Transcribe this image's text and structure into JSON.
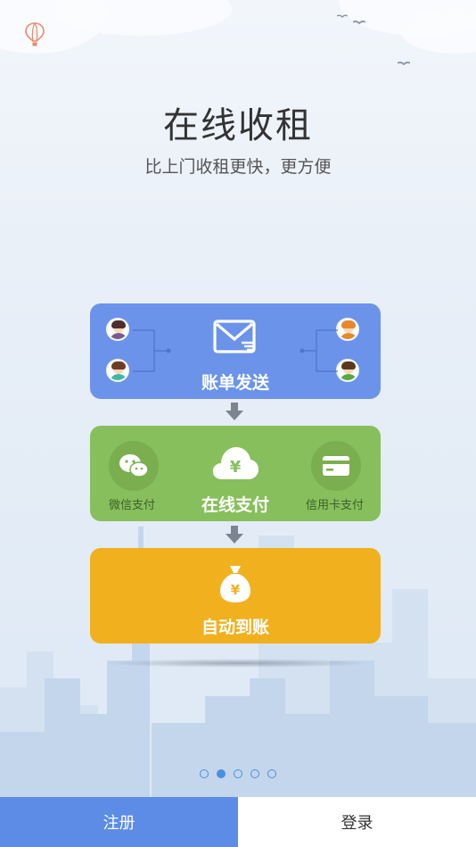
{
  "hero": {
    "title": "在线收租",
    "subtitle": "比上门收租更快，更方便"
  },
  "steps": [
    {
      "label": "账单发送",
      "icon": "mail-icon",
      "color": "#6b93ea"
    },
    {
      "label": "在线支付",
      "icon": "yuan-cloud-icon",
      "color": "#87bf5c",
      "methods": [
        {
          "label": "微信支付",
          "icon": "wechat-icon"
        },
        {
          "label": "信用卡支付",
          "icon": "credit-card-icon"
        }
      ]
    },
    {
      "label": "自动到账",
      "icon": "money-bag-icon",
      "color": "#f1b01d"
    }
  ],
  "pagination": {
    "total": 5,
    "active": 2
  },
  "buttons": {
    "register": "注册",
    "login": "登录"
  },
  "colors": {
    "primary": "#5d8ce6",
    "dot": "#4a90e2"
  }
}
